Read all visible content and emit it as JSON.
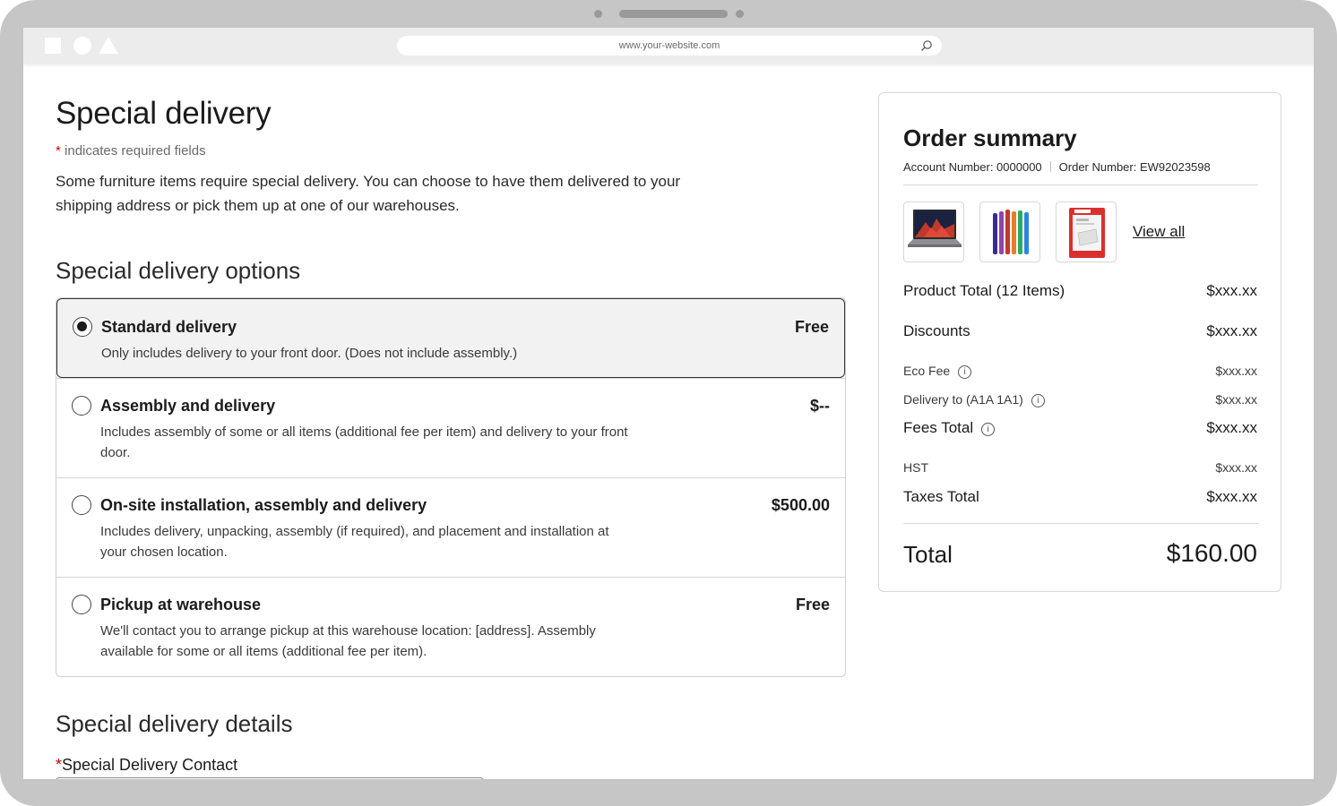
{
  "browser": {
    "url": "www.your-website.com"
  },
  "page": {
    "title": "Special delivery",
    "required_star": "*",
    "required_note": "indicates required fields",
    "intro": "Some furniture items require special delivery. You can choose to have them delivered to your shipping address or pick them up at one of our warehouses."
  },
  "options_section": {
    "title": "Special delivery options",
    "options": [
      {
        "title": "Standard delivery",
        "price": "Free",
        "description": "Only includes delivery to your front door. (Does not include assembly.)",
        "selected": true
      },
      {
        "title": "Assembly and delivery",
        "price": "$--",
        "description": "Includes assembly of some or all items (additional fee per item) and delivery to your front door.",
        "selected": false
      },
      {
        "title": "On-site installation, assembly and delivery",
        "price": "$500.00",
        "description": "Includes delivery, unpacking, assembly (if required), and placement and installation at your chosen location.",
        "selected": false
      },
      {
        "title": "Pickup at warehouse",
        "price": "Free",
        "description": "We'll contact you to arrange pickup at this warehouse location: [address]. Assembly available for some or all items (additional fee per item).",
        "selected": false
      }
    ]
  },
  "details_section": {
    "title": "Special delivery details",
    "contact_star": "*",
    "contact_label": "Special Delivery Contact"
  },
  "summary": {
    "title": "Order summary",
    "account_number": "Account Number: 0000000",
    "order_number": "Order Number: EW92023598",
    "thumbnails": [
      "laptop-thumbnail",
      "pens-thumbnail",
      "paper-ream-thumbnail"
    ],
    "view_all": "View all",
    "product_total_label": "Product Total (12 Items)",
    "product_total_value": "$xxx.xx",
    "discounts_label": "Discounts",
    "discounts_value": "$xxx.xx",
    "eco_fee_label": "Eco Fee",
    "eco_fee_value": "$xxx.xx",
    "delivery_label": "Delivery to (A1A 1A1)",
    "delivery_value": "$xxx.xx",
    "fees_total_label": "Fees Total",
    "fees_total_value": "$xxx.xx",
    "hst_label": "HST",
    "hst_value": "$xxx.xx",
    "taxes_total_label": "Taxes Total",
    "taxes_total_value": "$xxx.xx",
    "total_label": "Total",
    "total_value": "$160.00"
  },
  "icons": {
    "info": "info-icon",
    "search": "search-icon"
  },
  "colors": {
    "required": "#cc0000",
    "selected_option_bg": "#f2f2f2",
    "device_frame": "#c6c6c6"
  }
}
